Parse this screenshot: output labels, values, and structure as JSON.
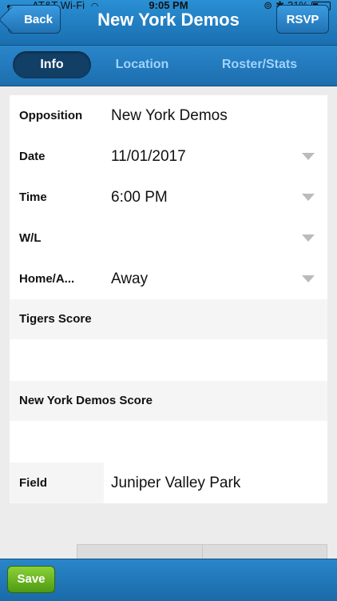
{
  "status_bar": {
    "carrier": "AT&T Wi-Fi",
    "time": "9:05 PM",
    "battery": "31%",
    "battery_level": 0.31
  },
  "header": {
    "back_label": "Back",
    "title": "New York Demos",
    "rsvp_label": "RSVP"
  },
  "tabs": [
    {
      "label": "Info",
      "active": true
    },
    {
      "label": "Location",
      "active": false
    },
    {
      "label": "Roster/Stats",
      "active": false
    }
  ],
  "form": {
    "opposition": {
      "label": "Opposition",
      "value": "New York Demos"
    },
    "date": {
      "label": "Date",
      "value": "11/01/2017"
    },
    "time": {
      "label": "Time",
      "value": "6:00 PM"
    },
    "wl": {
      "label": "W/L",
      "value": ""
    },
    "home_away": {
      "label": "Home/A...",
      "value": "Away"
    },
    "tigers_score": {
      "label": "Tigers Score",
      "value": ""
    },
    "opponent_score": {
      "label": "New York Demos Score",
      "value": ""
    },
    "field": {
      "label": "Field",
      "value": "Juniper Valley Park"
    }
  },
  "footer": {
    "save_label": "Save"
  },
  "colors": {
    "header_blue": "#1a6fb0",
    "active_tab": "#123f66",
    "save_green": "#5ea818"
  }
}
